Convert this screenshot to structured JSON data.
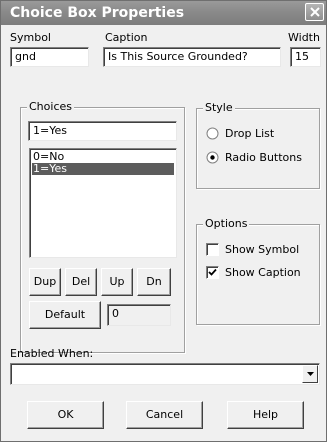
{
  "window": {
    "title": "Choice Box Properties"
  },
  "symbol": {
    "label": "Symbol",
    "value": "gnd"
  },
  "caption": {
    "label": "Caption",
    "value": "Is This Source Grounded?"
  },
  "width": {
    "label": "Width",
    "value": "15"
  },
  "choices": {
    "label": "Choices",
    "edit_value": "1=Yes",
    "items": [
      "0=No",
      "1=Yes"
    ],
    "selected_index": 1,
    "buttons": {
      "dup": "Dup",
      "del": "Del",
      "up": "Up",
      "dn": "Dn",
      "default": "Default"
    },
    "default_value": "0"
  },
  "style": {
    "label": "Style",
    "options": [
      "Drop List",
      "Radio Buttons"
    ],
    "selected": "Radio Buttons"
  },
  "options": {
    "label": "Options",
    "show_symbol": {
      "label": "Show Symbol",
      "checked": false
    },
    "show_caption": {
      "label": "Show Caption",
      "checked": true
    }
  },
  "enabled_when": {
    "label": "Enabled When:",
    "value": ""
  },
  "footer": {
    "ok": "OK",
    "cancel": "Cancel",
    "help": "Help"
  },
  "icons": {
    "close": "close-icon",
    "dropdown": "chevron-down-icon",
    "checkmark": "checkmark-icon"
  }
}
